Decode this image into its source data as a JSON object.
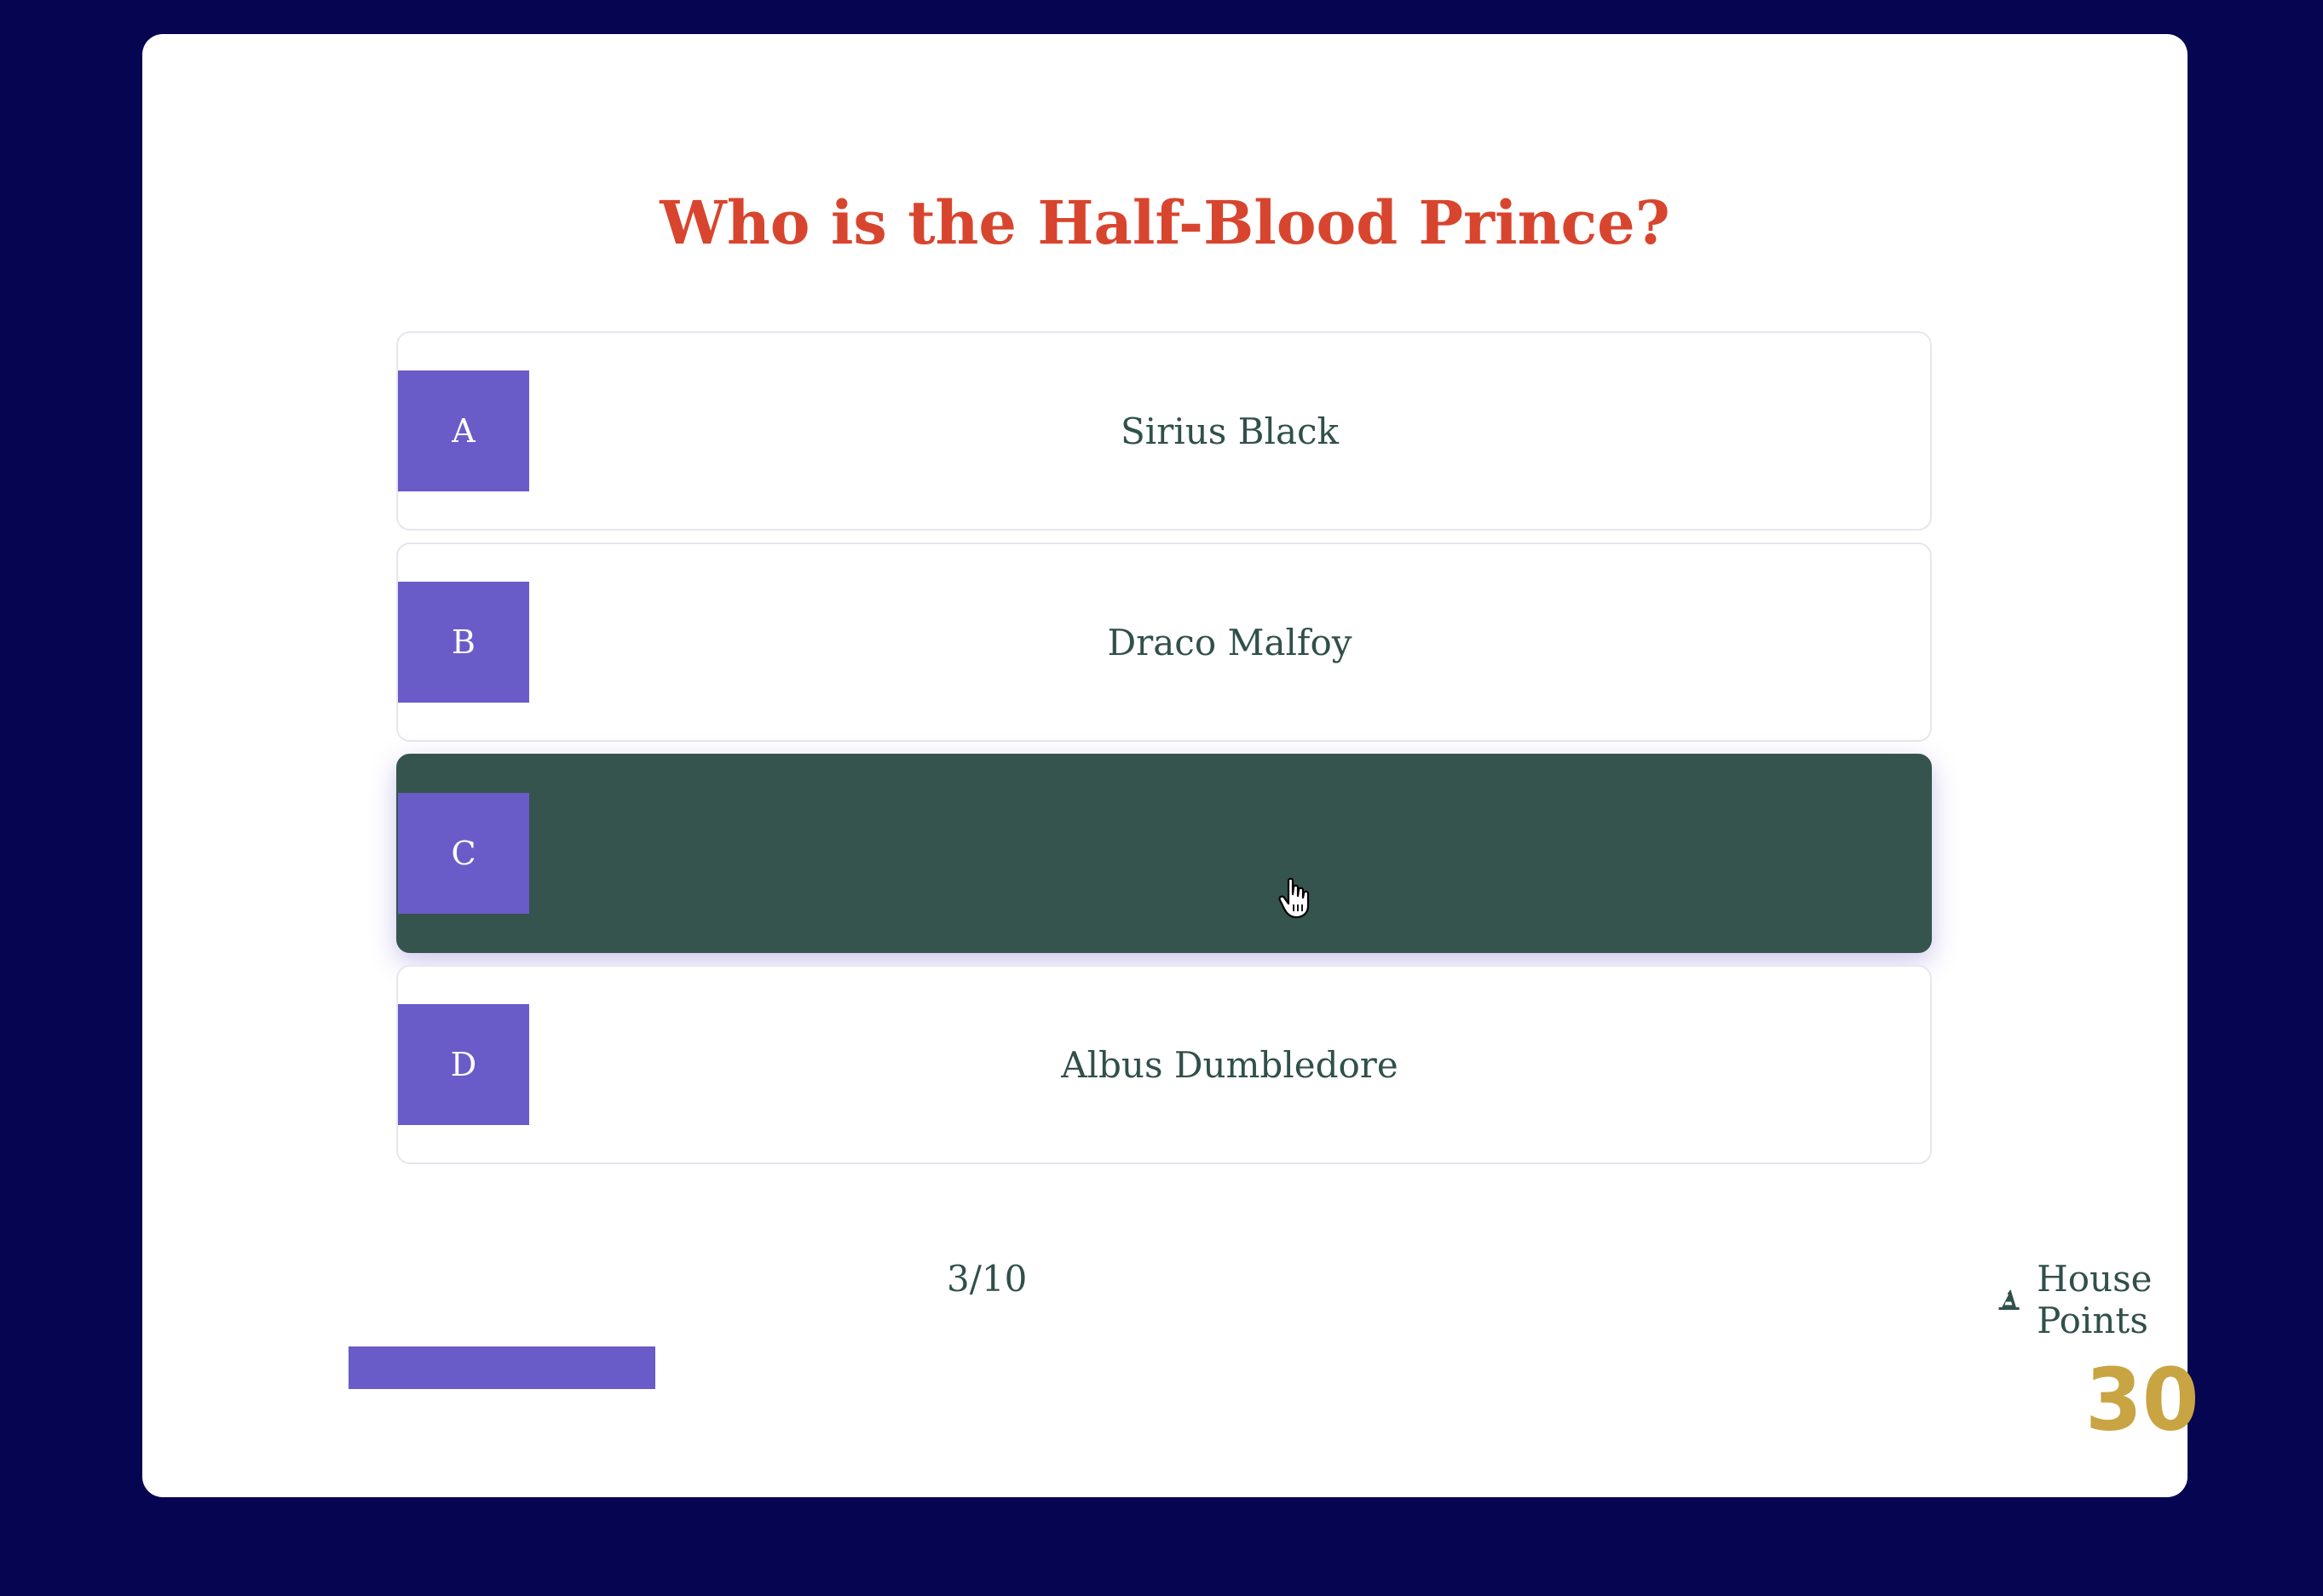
{
  "question": "Who is the Half-Blood Prince?",
  "options": [
    {
      "letter": "A",
      "text": "Sirius Black"
    },
    {
      "letter": "B",
      "text": "Draco Malfoy"
    },
    {
      "letter": "C",
      "text": ""
    },
    {
      "letter": "D",
      "text": "Albus Dumbledore"
    }
  ],
  "selected_option": "C",
  "progress": {
    "counter": "3/10",
    "fraction": 0.3
  },
  "house_points": {
    "label": "House Points",
    "icon": "wizard-hat-icon",
    "value": "30"
  },
  "colors": {
    "background": "#060552",
    "question": "#d8452e",
    "accent": "#6a5cc8",
    "selected": "#36544e",
    "score": "#c9a443"
  }
}
